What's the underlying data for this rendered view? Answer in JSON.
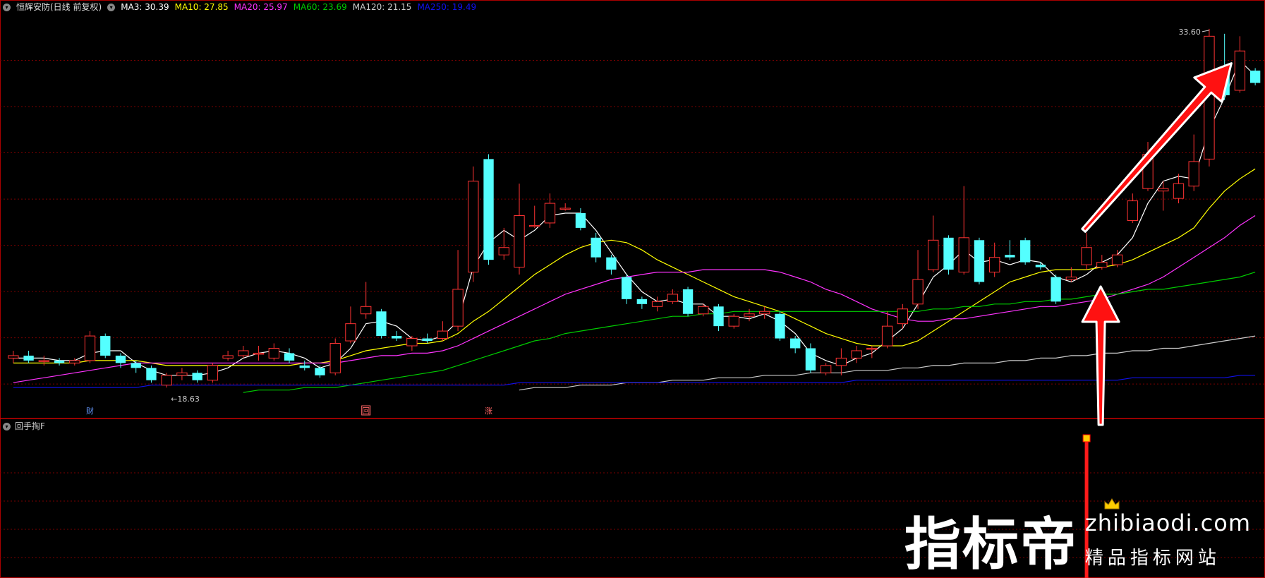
{
  "header": {
    "title": "恒辉安防(日线 前复权)",
    "ma": [
      {
        "label": "MA3: 30.39",
        "color": "#ffffff"
      },
      {
        "label": "MA10: 27.85",
        "color": "#ffff00"
      },
      {
        "label": "MA20: 25.97",
        "color": "#ff33ff"
      },
      {
        "label": "MA60: 23.69",
        "color": "#00cc00"
      },
      {
        "label": "MA120: 21.15",
        "color": "#cccccc"
      },
      {
        "label": "MA250: 19.49",
        "color": "#1111ee"
      }
    ]
  },
  "indicator_panel": {
    "title": "回手掏F"
  },
  "chart_data": {
    "type": "candlestick",
    "ylim": [
      18.0,
      34.2
    ],
    "price_labels": {
      "high": "33.60",
      "low": "18.63"
    },
    "candles": [
      [
        20.2,
        20.3,
        20.5,
        20.0
      ],
      [
        20.3,
        20.1,
        20.5,
        20.0
      ],
      [
        20.1,
        20.1,
        20.3,
        19.9
      ],
      [
        20.1,
        20.0,
        20.2,
        19.9
      ],
      [
        20.0,
        20.1,
        20.2,
        19.9
      ],
      [
        20.1,
        21.1,
        21.3,
        20.0
      ],
      [
        21.1,
        20.3,
        21.2,
        20.2
      ],
      [
        20.3,
        20.0,
        20.4,
        19.8
      ],
      [
        20.0,
        19.8,
        20.1,
        19.6
      ],
      [
        19.8,
        19.3,
        19.9,
        19.2
      ],
      [
        19.1,
        19.5,
        19.6,
        19.0
      ],
      [
        19.5,
        19.6,
        19.8,
        19.3
      ],
      [
        19.6,
        19.3,
        19.7,
        19.2
      ],
      [
        19.3,
        19.9,
        20.0,
        19.2
      ],
      [
        20.2,
        20.3,
        20.5,
        20.1
      ],
      [
        20.3,
        20.5,
        20.7,
        20.2
      ],
      [
        20.4,
        20.4,
        20.7,
        20.1
      ],
      [
        20.2,
        20.6,
        20.8,
        20.1
      ],
      [
        20.4,
        20.1,
        20.6,
        20.0
      ],
      [
        19.9,
        19.8,
        20.1,
        19.7
      ],
      [
        19.8,
        19.5,
        19.9,
        19.4
      ],
      [
        19.6,
        20.8,
        21.0,
        19.5
      ],
      [
        20.9,
        21.6,
        22.3,
        20.8
      ],
      [
        22.0,
        22.3,
        23.3,
        21.8
      ],
      [
        22.1,
        21.1,
        22.2,
        21.0
      ],
      [
        21.1,
        21.0,
        21.3,
        20.9
      ],
      [
        20.7,
        21.0,
        21.1,
        20.5
      ],
      [
        21.0,
        20.9,
        21.2,
        20.8
      ],
      [
        21.0,
        21.3,
        21.7,
        20.9
      ],
      [
        21.5,
        23.0,
        24.6,
        21.3
      ],
      [
        23.7,
        27.4,
        28.0,
        23.3
      ],
      [
        28.3,
        24.2,
        28.5,
        24.0
      ],
      [
        24.4,
        24.7,
        25.5,
        24.2
      ],
      [
        23.9,
        26.0,
        27.3,
        23.6
      ],
      [
        25.6,
        25.6,
        26.4,
        25.5
      ],
      [
        25.7,
        26.5,
        26.9,
        25.5
      ],
      [
        26.3,
        26.3,
        26.5,
        26.2
      ],
      [
        26.1,
        25.5,
        26.3,
        25.4
      ],
      [
        25.1,
        24.3,
        25.3,
        24.1
      ],
      [
        24.3,
        23.8,
        24.4,
        23.6
      ],
      [
        23.5,
        22.6,
        23.6,
        22.4
      ],
      [
        22.6,
        22.4,
        22.7,
        22.2
      ],
      [
        22.3,
        22.5,
        22.7,
        22.1
      ],
      [
        22.5,
        22.8,
        23.0,
        22.4
      ],
      [
        23.0,
        22.0,
        23.1,
        21.9
      ],
      [
        22.0,
        22.3,
        22.4,
        21.9
      ],
      [
        22.3,
        21.5,
        22.4,
        21.3
      ],
      [
        21.5,
        21.9,
        22.0,
        21.4
      ],
      [
        21.9,
        22.0,
        22.2,
        21.7
      ],
      [
        22.0,
        22.1,
        22.3,
        21.8
      ],
      [
        22.0,
        21.0,
        22.1,
        20.9
      ],
      [
        21.0,
        20.6,
        21.1,
        20.4
      ],
      [
        20.6,
        19.7,
        20.8,
        19.6
      ],
      [
        19.6,
        19.9,
        20.0,
        19.5
      ],
      [
        19.9,
        20.2,
        20.6,
        19.5
      ],
      [
        20.2,
        20.5,
        20.7,
        20.0
      ],
      [
        20.6,
        20.6,
        20.7,
        20.2
      ],
      [
        20.7,
        21.5,
        22.1,
        20.6
      ],
      [
        21.6,
        22.2,
        22.4,
        21.4
      ],
      [
        22.4,
        23.4,
        24.6,
        22.2
      ],
      [
        23.8,
        25.0,
        26.0,
        23.7
      ],
      [
        25.1,
        23.8,
        25.2,
        23.6
      ],
      [
        23.7,
        25.1,
        27.2,
        23.6
      ],
      [
        25.0,
        23.3,
        25.1,
        23.2
      ],
      [
        23.7,
        24.3,
        24.9,
        23.5
      ],
      [
        24.4,
        24.3,
        25.0,
        24.2
      ],
      [
        25.0,
        24.1,
        25.1,
        24.0
      ],
      [
        24.0,
        23.9,
        24.1,
        23.8
      ],
      [
        23.5,
        22.5,
        23.6,
        22.4
      ],
      [
        23.4,
        23.5,
        23.9,
        23.3
      ],
      [
        24.0,
        24.7,
        25.3,
        23.8
      ],
      [
        23.9,
        24.1,
        24.4,
        23.8
      ],
      [
        24.0,
        24.4,
        24.6,
        23.9
      ],
      [
        25.8,
        26.6,
        26.9,
        25.7
      ],
      [
        27.1,
        28.5,
        29.0,
        27.0
      ],
      [
        27.0,
        27.1,
        27.4,
        26.2
      ],
      [
        26.7,
        27.3,
        27.7,
        26.5
      ],
      [
        27.2,
        28.2,
        29.3,
        27.0
      ],
      [
        28.3,
        33.3,
        33.6,
        28.0
      ],
      [
        31.8,
        30.9,
        33.4,
        30.7
      ],
      [
        31.1,
        32.7,
        33.3,
        31.0
      ],
      [
        31.9,
        31.4,
        32.0,
        31.3
      ]
    ],
    "ma_series": [
      {
        "name": "MA3",
        "color": "#ffffff",
        "values": [
          20.2,
          20.2,
          20.2,
          20.1,
          20.1,
          20.4,
          20.5,
          20.5,
          20.0,
          19.7,
          19.5,
          19.5,
          19.5,
          19.6,
          19.8,
          20.2,
          20.4,
          20.5,
          20.4,
          20.2,
          19.8,
          20.0,
          20.6,
          21.6,
          21.7,
          21.5,
          21.0,
          20.9,
          21.1,
          21.7,
          23.9,
          24.9,
          25.4,
          25.0,
          25.4,
          26.0,
          26.1,
          26.1,
          25.4,
          24.5,
          23.6,
          22.9,
          22.5,
          22.6,
          22.4,
          22.4,
          21.9,
          21.9,
          21.8,
          22.0,
          21.7,
          21.2,
          20.4,
          20.1,
          19.9,
          20.2,
          20.4,
          20.9,
          21.4,
          22.4,
          23.5,
          24.0,
          24.6,
          24.1,
          24.2,
          24.0,
          24.2,
          24.1,
          23.5,
          23.3,
          23.6,
          24.1,
          24.4,
          25.1,
          26.5,
          27.4,
          27.6,
          27.5,
          29.5,
          30.8,
          32.3,
          31.7
        ]
      },
      {
        "name": "MA10",
        "color": "#ffff00",
        "values": [
          20.0,
          20.0,
          20.0,
          20.0,
          20.0,
          20.1,
          20.1,
          20.1,
          20.1,
          20.0,
          19.9,
          19.9,
          19.9,
          19.9,
          19.9,
          19.9,
          19.9,
          19.9,
          19.9,
          20.0,
          20.0,
          20.1,
          20.3,
          20.5,
          20.6,
          20.7,
          20.8,
          20.8,
          20.9,
          21.2,
          21.7,
          22.1,
          22.6,
          23.1,
          23.6,
          24.0,
          24.4,
          24.7,
          24.9,
          25.0,
          24.9,
          24.6,
          24.2,
          23.9,
          23.6,
          23.3,
          23.0,
          22.7,
          22.5,
          22.3,
          22.1,
          21.8,
          21.5,
          21.2,
          21.0,
          20.8,
          20.7,
          20.7,
          20.7,
          20.9,
          21.3,
          21.7,
          22.1,
          22.5,
          22.9,
          23.3,
          23.5,
          23.7,
          23.8,
          23.8,
          23.8,
          23.9,
          24.0,
          24.2,
          24.5,
          24.8,
          25.1,
          25.5,
          26.3,
          27.0,
          27.5,
          27.9
        ]
      },
      {
        "name": "MA20",
        "color": "#ff33ff",
        "values": [
          19.2,
          19.3,
          19.4,
          19.5,
          19.6,
          19.7,
          19.8,
          19.9,
          20.0,
          20.0,
          20.0,
          20.0,
          20.0,
          20.0,
          20.0,
          20.0,
          20.0,
          20.0,
          20.0,
          20.0,
          20.0,
          20.0,
          20.1,
          20.2,
          20.3,
          20.3,
          20.4,
          20.4,
          20.5,
          20.7,
          21.0,
          21.3,
          21.6,
          21.9,
          22.2,
          22.5,
          22.8,
          23.0,
          23.2,
          23.4,
          23.5,
          23.6,
          23.7,
          23.7,
          23.7,
          23.8,
          23.8,
          23.8,
          23.8,
          23.8,
          23.7,
          23.5,
          23.3,
          23.0,
          22.8,
          22.5,
          22.2,
          22.0,
          21.8,
          21.7,
          21.7,
          21.8,
          21.8,
          21.9,
          22.0,
          22.1,
          22.2,
          22.3,
          22.3,
          22.4,
          22.5,
          22.6,
          22.8,
          23.0,
          23.2,
          23.5,
          23.9,
          24.3,
          24.7,
          25.1,
          25.6,
          26.0
        ]
      },
      {
        "name": "MA60",
        "color": "#00cc00",
        "values": [
          null,
          null,
          null,
          null,
          null,
          null,
          null,
          null,
          null,
          null,
          null,
          null,
          null,
          null,
          null,
          18.8,
          18.9,
          18.9,
          18.9,
          19.0,
          19.0,
          19.0,
          19.1,
          19.2,
          19.3,
          19.4,
          19.5,
          19.6,
          19.7,
          19.9,
          20.1,
          20.3,
          20.5,
          20.7,
          20.9,
          21.0,
          21.2,
          21.3,
          21.4,
          21.5,
          21.6,
          21.7,
          21.8,
          21.9,
          21.9,
          22.0,
          22.0,
          22.1,
          22.1,
          22.1,
          22.1,
          22.1,
          22.1,
          22.1,
          22.1,
          22.1,
          22.1,
          22.1,
          22.1,
          22.1,
          22.2,
          22.2,
          22.3,
          22.3,
          22.4,
          22.4,
          22.5,
          22.5,
          22.6,
          22.6,
          22.7,
          22.8,
          22.8,
          22.9,
          23.0,
          23.0,
          23.1,
          23.2,
          23.3,
          23.4,
          23.5,
          23.7
        ]
      },
      {
        "name": "MA120",
        "color": "#cccccc",
        "values": [
          null,
          null,
          null,
          null,
          null,
          null,
          null,
          null,
          null,
          null,
          null,
          null,
          null,
          null,
          null,
          null,
          null,
          null,
          null,
          null,
          null,
          null,
          null,
          null,
          null,
          null,
          null,
          null,
          null,
          null,
          null,
          null,
          null,
          18.9,
          19.0,
          19.0,
          19.0,
          19.1,
          19.1,
          19.1,
          19.2,
          19.2,
          19.2,
          19.3,
          19.3,
          19.3,
          19.4,
          19.4,
          19.4,
          19.5,
          19.5,
          19.5,
          19.6,
          19.6,
          19.6,
          19.7,
          19.7,
          19.7,
          19.8,
          19.8,
          19.9,
          19.9,
          20.0,
          20.0,
          20.0,
          20.1,
          20.1,
          20.2,
          20.2,
          20.3,
          20.3,
          20.4,
          20.4,
          20.5,
          20.5,
          20.6,
          20.6,
          20.7,
          20.8,
          20.9,
          21.0,
          21.1
        ]
      },
      {
        "name": "MA250",
        "color": "#1111ee",
        "values": [
          19.0,
          19.0,
          19.0,
          19.0,
          19.0,
          19.0,
          19.0,
          19.0,
          19.0,
          19.1,
          19.1,
          19.1,
          19.1,
          19.1,
          19.1,
          19.1,
          19.1,
          19.1,
          19.1,
          19.1,
          19.1,
          19.1,
          19.1,
          19.1,
          19.1,
          19.1,
          19.1,
          19.1,
          19.1,
          19.1,
          19.1,
          19.1,
          19.1,
          19.2,
          19.2,
          19.2,
          19.2,
          19.2,
          19.2,
          19.2,
          19.2,
          19.2,
          19.2,
          19.2,
          19.2,
          19.2,
          19.2,
          19.2,
          19.2,
          19.2,
          19.2,
          19.2,
          19.2,
          19.2,
          19.2,
          19.3,
          19.3,
          19.3,
          19.3,
          19.3,
          19.3,
          19.3,
          19.3,
          19.3,
          19.3,
          19.3,
          19.3,
          19.3,
          19.3,
          19.3,
          19.3,
          19.3,
          19.3,
          19.4,
          19.4,
          19.4,
          19.4,
          19.4,
          19.4,
          19.4,
          19.5,
          19.5
        ]
      }
    ],
    "events": [
      {
        "index": 5,
        "label": "财",
        "color": "#6699ff",
        "border": "none"
      },
      {
        "index": 23,
        "label": "回",
        "color": "#ff6666",
        "border": "#ff6666"
      },
      {
        "index": 31,
        "label": "涨",
        "color": "#ff6666",
        "border": "none"
      }
    ],
    "signal_index": 70,
    "arrows": [
      {
        "name": "up-arrow-left",
        "from_index": 70,
        "to_index": 70
      },
      {
        "name": "up-arrow-right",
        "from_index": 70,
        "to_index": 79
      }
    ]
  },
  "watermark": {
    "brand_cn": "指标帝",
    "domain": "zhibiaodi.com",
    "tagline": "精品指标网站"
  }
}
